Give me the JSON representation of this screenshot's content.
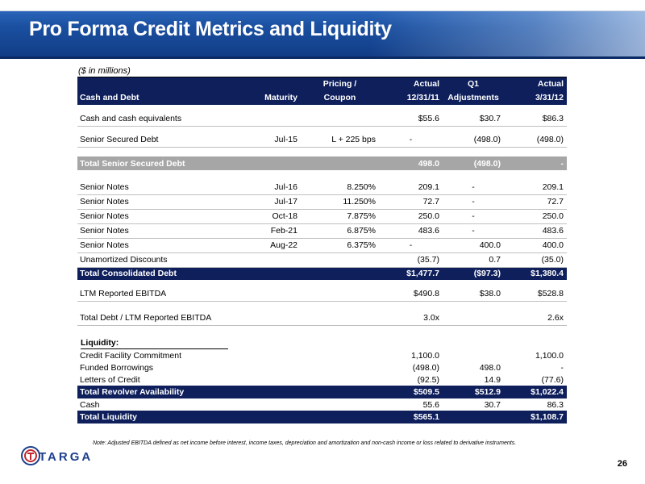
{
  "title": "Pro Forma Credit Metrics and Liquidity",
  "units": "($ in millions)",
  "table": {
    "header_row1": [
      "",
      "",
      "Pricing /",
      "Actual",
      "Q1",
      "Actual"
    ],
    "header_row2": [
      "Cash and Debt",
      "Maturity",
      "Coupon",
      "12/31/11",
      "Adjustments",
      "3/31/12"
    ],
    "rows": {
      "cash": [
        "Cash and cash equivalents",
        "",
        "",
        "$55.6",
        "$30.7",
        "$86.3"
      ],
      "ssd": [
        "Senior Secured Debt",
        "Jul-15",
        "L + 225 bps",
        "-",
        "(498.0)",
        "(498.0)"
      ],
      "total_ssd": [
        "Total Senior Secured Debt",
        "",
        "",
        "498.0",
        "(498.0)",
        "-"
      ],
      "sn1": [
        "Senior Notes",
        "Jul-16",
        "8.250%",
        "209.1",
        "-",
        "209.1"
      ],
      "sn2": [
        "Senior Notes",
        "Jul-17",
        "11.250%",
        "72.7",
        "-",
        "72.7"
      ],
      "sn3": [
        "Senior Notes",
        "Oct-18",
        "7.875%",
        "250.0",
        "-",
        "250.0"
      ],
      "sn4": [
        "Senior Notes",
        "Feb-21",
        "6.875%",
        "483.6",
        "-",
        "483.6"
      ],
      "sn5": [
        "Senior Notes",
        "Aug-22",
        "6.375%",
        "-",
        "400.0",
        "400.0"
      ],
      "unamort": [
        "Unamortized Discounts",
        "",
        "",
        "(35.7)",
        "0.7",
        "(35.0)"
      ],
      "total_debt": [
        "Total  Consolidated Debt",
        "",
        "",
        "$1,477.7",
        "($97.3)",
        "$1,380.4"
      ],
      "ebitda": [
        "LTM Reported EBITDA",
        "",
        "",
        "$490.8",
        "$38.0",
        "$528.8"
      ],
      "leverage": [
        "Total Debt / LTM Reported EBITDA",
        "",
        "",
        "3.0x",
        "",
        "2.6x"
      ],
      "liquidity_label": "Liquidity:",
      "cfc": [
        "Credit Facility Commitment",
        "",
        "",
        "1,100.0",
        "",
        "1,100.0"
      ],
      "funded": [
        "Funded Borrowings",
        "",
        "",
        "(498.0)",
        "498.0",
        "-"
      ],
      "loc": [
        "Letters of Credit",
        "",
        "",
        "(92.5)",
        "14.9",
        "(77.6)"
      ],
      "total_rev": [
        "Total Revolver Availability",
        "",
        "",
        "$509.5",
        "$512.9",
        "$1,022.4"
      ],
      "cash2": [
        "Cash",
        "",
        "",
        "55.6",
        "30.7",
        "86.3"
      ],
      "total_liq": [
        "Total Liquidity",
        "",
        "",
        "$565.1",
        "",
        "$1,108.7"
      ]
    }
  },
  "note": "Note:     Adjusted EBITDA defined as net income before interest, income taxes, depreciation and amortization and non-cash income or loss related to derivative instruments.",
  "logo_text": "TARGA",
  "page_number": "26",
  "colors": {
    "navy": "#0e1f5c",
    "grey": "#a6a6a6",
    "title_blue": "#1a4fa0"
  }
}
